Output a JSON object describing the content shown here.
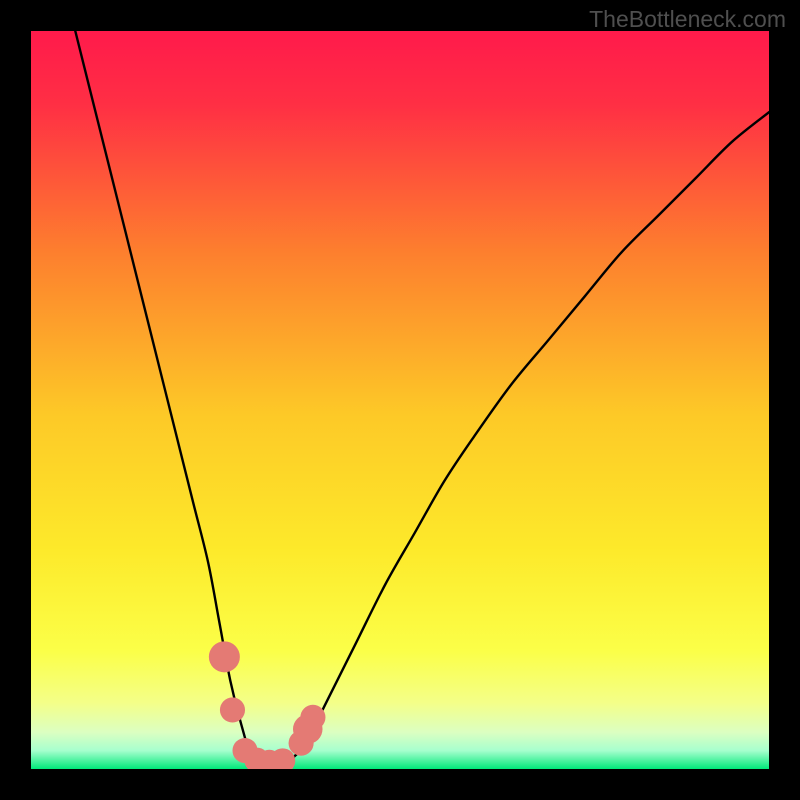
{
  "watermark": "TheBottleneck.com",
  "colors": {
    "gradient_top": "#ff1a4b",
    "gradient_upper_mid": "#fd7f2e",
    "gradient_mid": "#fde427",
    "gradient_lower": "#f9ff59",
    "gradient_pale": "#e8ffb0",
    "gradient_bottom": "#00e87a",
    "curve": "#000000",
    "markers": "#e47a74",
    "frame": "#000000"
  },
  "chart_data": {
    "type": "line",
    "title": "",
    "xlabel": "",
    "ylabel": "",
    "xlim": [
      0,
      100
    ],
    "ylim": [
      0,
      100
    ],
    "series": [
      {
        "name": "bottleneck-curve",
        "x": [
          6,
          8,
          10,
          12,
          14,
          16,
          18,
          20,
          22,
          24,
          25.5,
          27,
          28.5,
          30,
          32,
          34,
          36,
          38,
          40,
          44,
          48,
          52,
          56,
          60,
          65,
          70,
          75,
          80,
          85,
          90,
          95,
          100
        ],
        "y": [
          100,
          92,
          84,
          76,
          68,
          60,
          52,
          44,
          36,
          28,
          20,
          12,
          6,
          1.5,
          0.5,
          0.8,
          2,
          5,
          9,
          17,
          25,
          32,
          39,
          45,
          52,
          58,
          64,
          70,
          75,
          80,
          85,
          89
        ]
      }
    ],
    "markers": [
      {
        "x": 26.2,
        "y": 15.2,
        "r": 2.1
      },
      {
        "x": 27.3,
        "y": 8.0,
        "r": 1.7
      },
      {
        "x": 29.0,
        "y": 2.5,
        "r": 1.7
      },
      {
        "x": 30.6,
        "y": 1.2,
        "r": 1.7
      },
      {
        "x": 32.3,
        "y": 0.9,
        "r": 1.7
      },
      {
        "x": 34.1,
        "y": 1.1,
        "r": 1.7
      },
      {
        "x": 36.6,
        "y": 3.5,
        "r": 1.7
      },
      {
        "x": 37.5,
        "y": 5.4,
        "r": 2.0
      },
      {
        "x": 38.2,
        "y": 7.0,
        "r": 1.7
      }
    ]
  }
}
